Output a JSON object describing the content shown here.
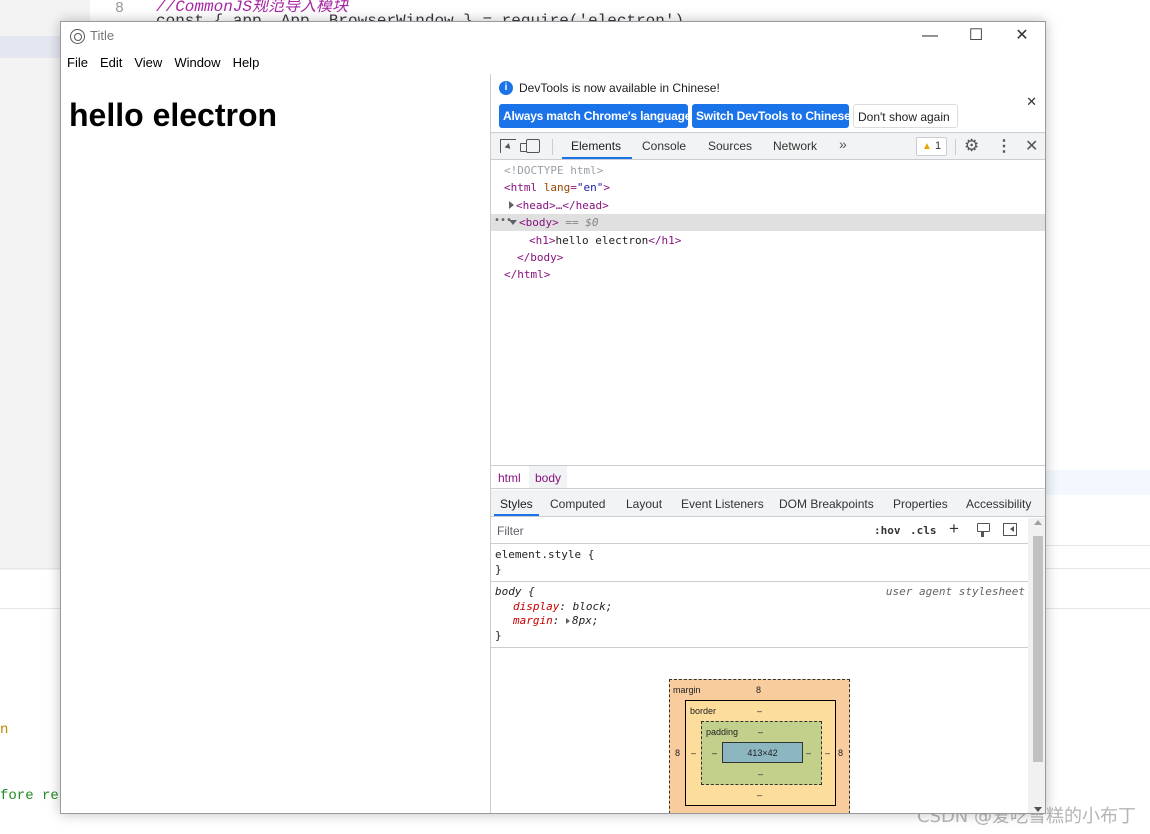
{
  "background": {
    "gutter_number": "8",
    "code_comment": "//CommonJS规范导入模块",
    "code_line": "const { app, App, BrowserWindow } = require('electron')",
    "terminal_line1": "n",
    "terminal_line2": "fore res",
    "watermark": "CSDN @爱吃雪糕的小布丁"
  },
  "window": {
    "title": "Title",
    "controls": {
      "minimize": "—",
      "maximize": "☐",
      "close": "✕"
    },
    "menu": [
      "File",
      "Edit",
      "View",
      "Window",
      "Help"
    ]
  },
  "page": {
    "heading": "hello electron"
  },
  "devtools": {
    "infobar": {
      "message": "DevTools is now available in Chinese!",
      "btn_match": "Always match Chrome's language",
      "btn_switch": "Switch DevTools to Chinese",
      "btn_dismiss": "Don't show again",
      "close": "✕"
    },
    "tabs": [
      "Elements",
      "Console",
      "Sources",
      "Network"
    ],
    "active_tab": "Elements",
    "more_tabs": "»",
    "warnings_count": "1",
    "close": "✕",
    "dom": {
      "doctype": "<!DOCTYPE html>",
      "html_open_tag": "<html",
      "html_lang_attr": "lang",
      "html_lang_val": "\"en\"",
      "head_collapsed": "<head>…</head>",
      "body_open": "<body>",
      "body_eq": "== $0",
      "h1_open": "<h1>",
      "h1_text": "hello electron",
      "h1_close": "</h1>",
      "body_close": "</body>",
      "html_close": "</html>"
    },
    "breadcrumbs": [
      "html",
      "body"
    ],
    "subtabs": [
      "Styles",
      "Computed",
      "Layout",
      "Event Listeners",
      "DOM Breakpoints",
      "Properties",
      "Accessibility"
    ],
    "active_subtab": "Styles",
    "filter_placeholder": "Filter",
    "hov": ":hov",
    "cls": ".cls",
    "styles": {
      "element_style_selector": "element.style {",
      "close_brace": "}",
      "body_selector": "body {",
      "source": "user agent stylesheet",
      "prop1_name": "display",
      "prop1_value": "block;",
      "prop2_name": "margin",
      "prop2_value": "8px;"
    },
    "box_model": {
      "margin_label": "margin",
      "margin_top": "8",
      "margin_left": "8",
      "margin_right": "8",
      "margin_bottom": "–",
      "border_label": "border",
      "border_value": "–",
      "padding_label": "padding",
      "padding_value": "–",
      "content_size": "413×42"
    }
  }
}
